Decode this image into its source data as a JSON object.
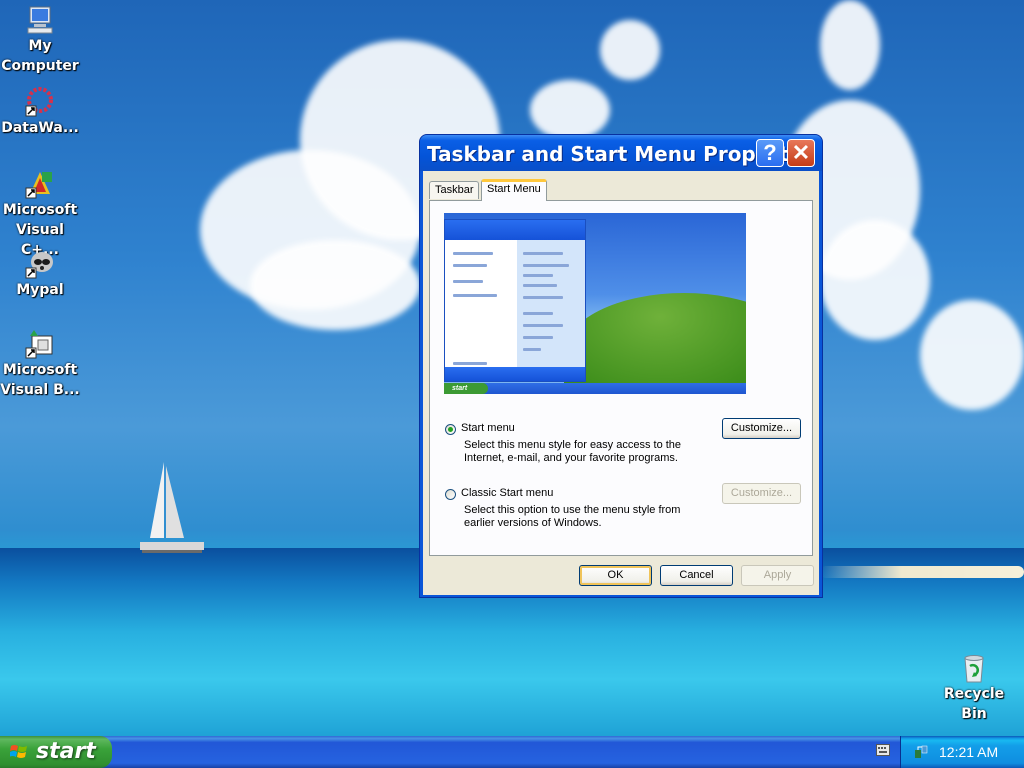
{
  "desktop": {
    "icons": [
      {
        "label": "My Computer"
      },
      {
        "label": "DataWa..."
      },
      {
        "label": "Microsoft Visual C+..."
      },
      {
        "label": "Mypal"
      },
      {
        "label": "Microsoft Visual B..."
      },
      {
        "label": "Recycle Bin"
      }
    ]
  },
  "dialog": {
    "title": "Taskbar and Start Menu Propert...",
    "help_symbol": "?",
    "close_symbol": "✕",
    "tabs": [
      {
        "label": "Taskbar",
        "selected": false
      },
      {
        "label": "Start Menu",
        "selected": true
      }
    ],
    "preview": {
      "start_label": "start"
    },
    "options": [
      {
        "label": "Start menu",
        "checked": true,
        "description": "Select this menu style for easy access to the Internet, e-mail, and your favorite programs.",
        "customize_label": "Customize...",
        "customize_enabled": true
      },
      {
        "label": "Classic Start menu",
        "checked": false,
        "description": "Select this option to use the menu style from earlier versions of Windows.",
        "customize_label": "Customize...",
        "customize_enabled": false
      }
    ],
    "buttons": {
      "ok": "OK",
      "cancel": "Cancel",
      "apply": "Apply"
    }
  },
  "taskbar": {
    "start_label": "start",
    "clock": "12:21 AM"
  },
  "colors": {
    "title_bar": "#0454d8",
    "start_green": "#3aa23a",
    "taskbar_blue": "#2663e0",
    "tray_blue": "#0f8ee0",
    "dialog_face": "#ece9d8"
  }
}
